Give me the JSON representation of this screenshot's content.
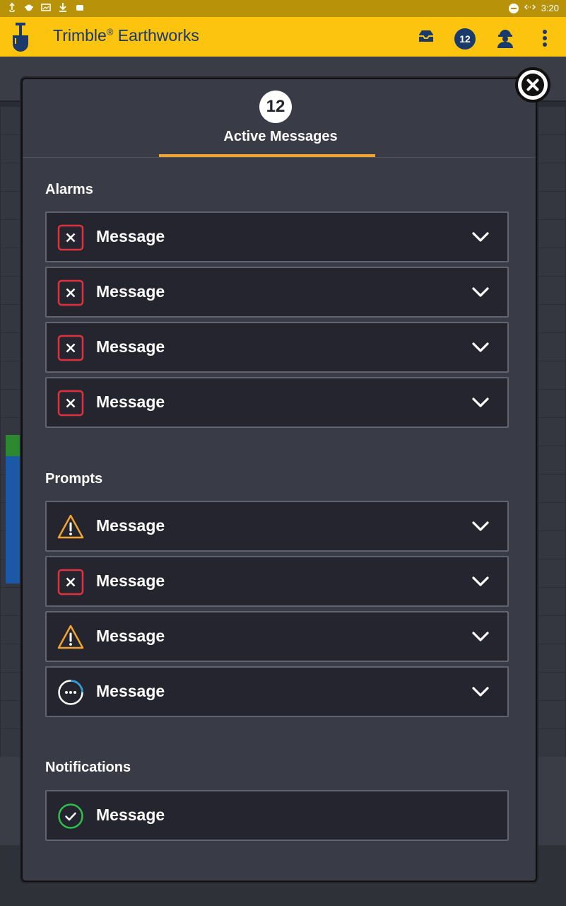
{
  "status_bar": {
    "time": "3:20"
  },
  "app": {
    "title": "Trimble",
    "title_mark": "®",
    "title_suffix": " Earthworks",
    "message_count": "12"
  },
  "dialog": {
    "count": "12",
    "title": "Active Messages",
    "sections": {
      "alarms": {
        "label": "Alarms",
        "items": [
          {
            "label": "Message",
            "type": "error"
          },
          {
            "label": "Message",
            "type": "error"
          },
          {
            "label": "Message",
            "type": "error"
          },
          {
            "label": "Message",
            "type": "error"
          }
        ]
      },
      "prompts": {
        "label": "Prompts",
        "items": [
          {
            "label": "Message",
            "type": "warning"
          },
          {
            "label": "Message",
            "type": "error"
          },
          {
            "label": "Message",
            "type": "warning"
          },
          {
            "label": "Message",
            "type": "progress"
          }
        ]
      },
      "notifications": {
        "label": "Notifications",
        "items": [
          {
            "label": "Message",
            "type": "success"
          }
        ]
      }
    }
  },
  "colors": {
    "brand_yellow": "#fcc30f",
    "brand_blue": "#1a3a6b",
    "error_red": "#e0323c",
    "warning_orange": "#f0a531",
    "success_green": "#2ec04a",
    "progress_blue": "#2a9fe0",
    "accent": "#f0a531"
  }
}
